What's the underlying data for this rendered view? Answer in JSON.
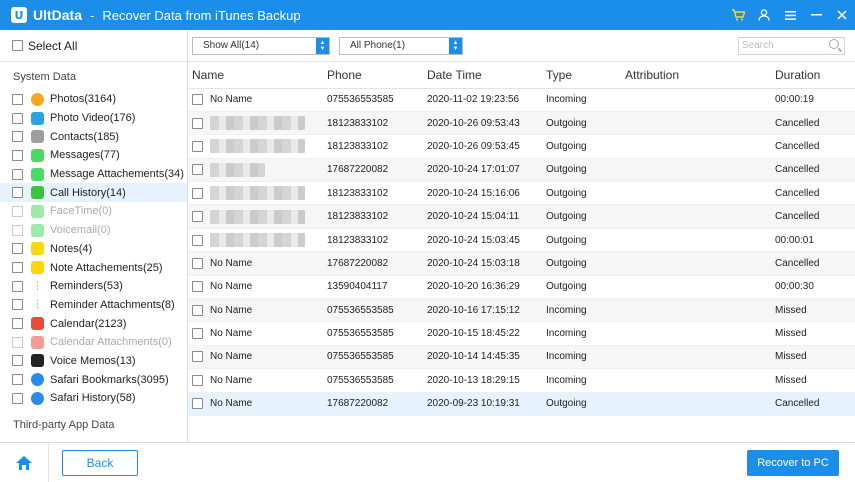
{
  "titlebar": {
    "logo_letter": "U",
    "app_name": "UltData",
    "separator": "-",
    "title": "Recover Data from iTunes Backup",
    "icons": [
      "cart-icon",
      "user-icon",
      "menu-icon",
      "minimize-icon",
      "close-icon"
    ]
  },
  "sidebar": {
    "select_all": "Select All",
    "system_title": "System Data",
    "items": [
      {
        "label": "Photos(3164)",
        "icon": "photos-icon",
        "color": "#f5a623",
        "dim": false,
        "active": false
      },
      {
        "label": "Photo Video(176)",
        "icon": "photo-video-icon",
        "color": "#2aa4e0",
        "dim": false,
        "active": false
      },
      {
        "label": "Contacts(185)",
        "icon": "contacts-icon",
        "color": "#9e9e9e",
        "dim": false,
        "active": false
      },
      {
        "label": "Messages(77)",
        "icon": "messages-icon",
        "color": "#4cd964",
        "dim": false,
        "active": false
      },
      {
        "label": "Message Attachements(34)",
        "icon": "message-attachments-icon",
        "color": "#4cd964",
        "dim": false,
        "active": false
      },
      {
        "label": "Call History(14)",
        "icon": "phone-icon",
        "color": "#3ec33e",
        "dim": false,
        "active": true
      },
      {
        "label": "FaceTime(0)",
        "icon": "facetime-icon",
        "color": "#4cd964",
        "dim": true,
        "active": false
      },
      {
        "label": "Voicemail(0)",
        "icon": "voicemail-icon",
        "color": "#4cd964",
        "dim": true,
        "active": false
      },
      {
        "label": "Notes(4)",
        "icon": "notes-icon",
        "color": "#ffd60a",
        "dim": false,
        "active": false
      },
      {
        "label": "Note Attachements(25)",
        "icon": "note-attachments-icon",
        "color": "#ffd60a",
        "dim": false,
        "active": false
      },
      {
        "label": "Reminders(53)",
        "icon": "reminders-icon",
        "color": "#6bb56b",
        "dim": false,
        "active": false
      },
      {
        "label": "Reminder Attachments(8)",
        "icon": "reminder-attachments-icon",
        "color": "#6bb56b",
        "dim": false,
        "active": false
      },
      {
        "label": "Calendar(2123)",
        "icon": "calendar-icon",
        "color": "#e94b3c",
        "dim": false,
        "active": false
      },
      {
        "label": "Calendar Attachments(0)",
        "icon": "calendar-attachments-icon",
        "color": "#e94b3c",
        "dim": true,
        "active": false
      },
      {
        "label": "Voice Memos(13)",
        "icon": "voice-memos-icon",
        "color": "#222222",
        "dim": false,
        "active": false
      },
      {
        "label": "Safari Bookmarks(3095)",
        "icon": "safari-bookmarks-icon",
        "color": "#2a8be8",
        "dim": false,
        "active": false
      },
      {
        "label": "Safari History(58)",
        "icon": "safari-history-icon",
        "color": "#2a8be8",
        "dim": false,
        "active": false
      }
    ],
    "third_party_title": "Third-party App Data"
  },
  "toolbar": {
    "filter_show": "Show All(14)",
    "filter_phone": "All Phone(1)",
    "search_placeholder": "Search"
  },
  "table": {
    "headers": [
      "Name",
      "Phone",
      "Date Time",
      "Type",
      "Attribution",
      "Duration"
    ],
    "rows": [
      {
        "name": "No Name",
        "blurred": false,
        "phone": "075536553585",
        "datetime": "2020-11-02 19:23:56",
        "type": "Incoming",
        "attribution": "",
        "duration": "00:00:19"
      },
      {
        "name": "",
        "blurred": true,
        "phone": "18123833102",
        "datetime": "2020-10-26 09:53:43",
        "type": "Outgoing",
        "attribution": "",
        "duration": "Cancelled"
      },
      {
        "name": "",
        "blurred": true,
        "phone": "18123833102",
        "datetime": "2020-10-26 09:53:45",
        "type": "Outgoing",
        "attribution": "",
        "duration": "Cancelled"
      },
      {
        "name": "",
        "blurred": "short",
        "phone": "17687220082",
        "datetime": "2020-10-24 17:01:07",
        "type": "Outgoing",
        "attribution": "",
        "duration": "Cancelled"
      },
      {
        "name": "",
        "blurred": true,
        "phone": "18123833102",
        "datetime": "2020-10-24 15:16:06",
        "type": "Outgoing",
        "attribution": "",
        "duration": "Cancelled"
      },
      {
        "name": "",
        "blurred": true,
        "phone": "18123833102",
        "datetime": "2020-10-24 15:04:11",
        "type": "Outgoing",
        "attribution": "",
        "duration": "Cancelled"
      },
      {
        "name": "",
        "blurred": true,
        "phone": "18123833102",
        "datetime": "2020-10-24 15:03:45",
        "type": "Outgoing",
        "attribution": "",
        "duration": "00:00:01"
      },
      {
        "name": "No Name",
        "blurred": false,
        "phone": "17687220082",
        "datetime": "2020-10-24 15:03:18",
        "type": "Outgoing",
        "attribution": "",
        "duration": "Cancelled"
      },
      {
        "name": "No Name",
        "blurred": false,
        "phone": "13590404117",
        "datetime": "2020-10-20 16:36:29",
        "type": "Outgoing",
        "attribution": "",
        "duration": "00:00:30"
      },
      {
        "name": "No Name",
        "blurred": false,
        "phone": "075536553585",
        "datetime": "2020-10-16 17:15:12",
        "type": "Incoming",
        "attribution": "",
        "duration": "Missed"
      },
      {
        "name": "No Name",
        "blurred": false,
        "phone": "075536553585",
        "datetime": "2020-10-15 18:45:22",
        "type": "Incoming",
        "attribution": "",
        "duration": "Missed"
      },
      {
        "name": "No Name",
        "blurred": false,
        "phone": "075536553585",
        "datetime": "2020-10-14 14:45:35",
        "type": "Incoming",
        "attribution": "",
        "duration": "Missed"
      },
      {
        "name": "No Name",
        "blurred": false,
        "phone": "075536553585",
        "datetime": "2020-10-13 18:29:15",
        "type": "Incoming",
        "attribution": "",
        "duration": "Missed"
      },
      {
        "name": "No Name",
        "blurred": false,
        "phone": "17687220082",
        "datetime": "2020-09-23 10:19:31",
        "type": "Outgoing",
        "attribution": "",
        "duration": "Cancelled",
        "selected": true
      }
    ]
  },
  "bottombar": {
    "back_label": "Back",
    "recover_label": "Recover to PC"
  },
  "colors": {
    "accent": "#1a8ee8",
    "cart": "#ffd23c",
    "selected_row": "#e6f2fd"
  }
}
